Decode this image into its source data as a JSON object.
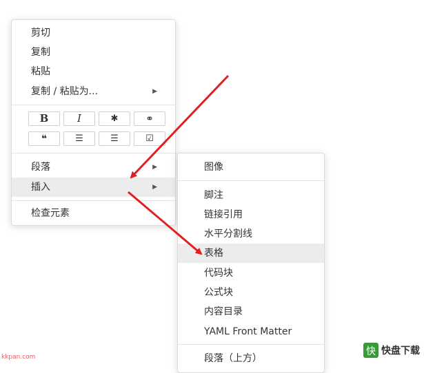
{
  "context_menu": {
    "items_top": [
      {
        "label": "剪切"
      },
      {
        "label": "复制"
      },
      {
        "label": "粘贴"
      },
      {
        "label": "复制 / 粘贴为...",
        "submenu": true
      }
    ],
    "format_buttons": [
      {
        "icon": "bold-icon",
        "glyph": "B"
      },
      {
        "icon": "italic-icon",
        "glyph": "I"
      },
      {
        "icon": "code-icon",
        "glyph": "✱"
      },
      {
        "icon": "link-icon",
        "glyph": "⚭"
      },
      {
        "icon": "quote-icon",
        "glyph": "❝"
      },
      {
        "icon": "ordered-list-icon",
        "glyph": "☰"
      },
      {
        "icon": "unordered-list-icon",
        "glyph": "☰"
      },
      {
        "icon": "task-list-icon",
        "glyph": "☑"
      }
    ],
    "items_mid": [
      {
        "label": "段落",
        "submenu": true
      },
      {
        "label": "插入",
        "submenu": true,
        "highlighted": true
      }
    ],
    "items_bottom": [
      {
        "label": "检查元素"
      }
    ]
  },
  "insert_submenu": {
    "items": [
      {
        "label": "图像"
      },
      {
        "label": "脚注"
      },
      {
        "label": "链接引用"
      },
      {
        "label": "水平分割线"
      },
      {
        "label": "表格",
        "highlighted": true
      },
      {
        "label": "代码块"
      },
      {
        "label": "公式块"
      },
      {
        "label": "内容目录"
      },
      {
        "label": "YAML Front Matter"
      },
      {
        "label": "段落（上方）"
      }
    ]
  },
  "annotation_color": "#e02020",
  "watermark_left": "kkpan.com",
  "watermark_right": {
    "brand": "快盘下载",
    "mark": "快"
  }
}
